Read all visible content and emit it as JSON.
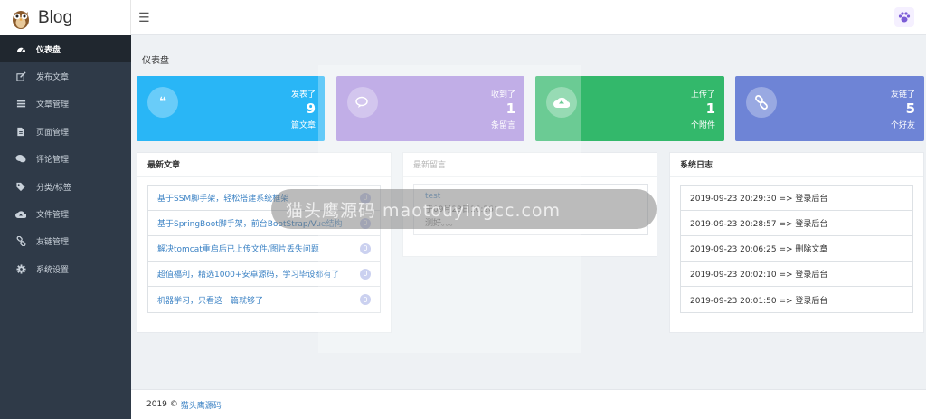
{
  "brand": {
    "name": "Blog"
  },
  "sidebar": {
    "items": [
      {
        "label": "仪表盘",
        "icon": "dashboard-icon",
        "active": true
      },
      {
        "label": "发布文章",
        "icon": "edit-icon"
      },
      {
        "label": "文章管理",
        "icon": "list-icon"
      },
      {
        "label": "页面管理",
        "icon": "file-icon"
      },
      {
        "label": "评论管理",
        "icon": "comments-icon"
      },
      {
        "label": "分类/标签",
        "icon": "tags-icon"
      },
      {
        "label": "文件管理",
        "icon": "cloud-upload-icon"
      },
      {
        "label": "友链管理",
        "icon": "link-icon"
      },
      {
        "label": "系统设置",
        "icon": "gear-icon"
      }
    ]
  },
  "page": {
    "title": "仪表盘"
  },
  "cards": [
    {
      "line1": "发表了",
      "count": "9",
      "line2": "篇文章",
      "color": "#29b6f6",
      "icon": "quote-icon"
    },
    {
      "line1": "收到了",
      "count": "1",
      "line2": "条留言",
      "color": "#a98fde",
      "icon": "comments-icon"
    },
    {
      "line1": "上传了",
      "count": "1",
      "line2": "个附件",
      "color": "#33b86b",
      "icon": "cloud-upload-icon"
    },
    {
      "line1": "友链了",
      "count": "5",
      "line2": "个好友",
      "color": "#6e84d6",
      "icon": "link-icon"
    }
  ],
  "latest_posts": {
    "title": "最新文章",
    "items": [
      {
        "title": "基于SSM脚手架，轻松搭建系统框架",
        "count": "0"
      },
      {
        "title": "基于SpringBoot脚手架，前台BootStrap/Vue结构",
        "count": "0"
      },
      {
        "title": "解决tomcat重启后已上传文件/图片丢失问题",
        "count": "0"
      },
      {
        "title": "超值福利，精选1000+安卓源码，学习毕设都有了",
        "count": "0"
      },
      {
        "title": "机器学习，只看这一篇就够了",
        "count": "0"
      }
    ]
  },
  "latest_comments": {
    "title": "最新留言",
    "items": [
      {
        "author": "test",
        "time": "于09月23日16:26：",
        "content": "测好。。。"
      }
    ]
  },
  "system_log": {
    "title": "系统日志",
    "items": [
      "2019-09-23 20:29:30 => 登录后台",
      "2019-09-23 20:28:57 => 登录后台",
      "2019-09-23 20:06:25 => 删除文章",
      "2019-09-23 20:02:10 => 登录后台",
      "2019-09-23 20:01:50 => 登录后台"
    ]
  },
  "footer": {
    "year": "2019 ©",
    "link": "猫头鹰源码"
  },
  "watermark": {
    "text": "猫头鹰源码  maotouyingcc.com"
  }
}
